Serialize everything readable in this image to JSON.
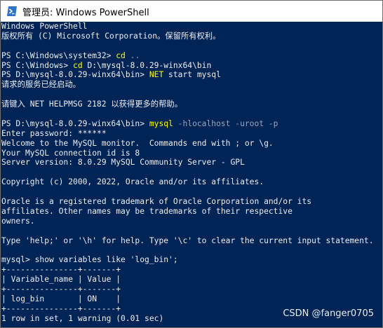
{
  "window": {
    "title": "管理员: Windows PowerShell",
    "icon": "powershell-icon"
  },
  "console": {
    "lines": [
      {
        "segments": [
          {
            "text": "Windows PowerShell",
            "style": "normal"
          }
        ]
      },
      {
        "segments": [
          {
            "text": "版权所有 (C) Microsoft Corporation。保留所有权利。",
            "style": "normal"
          }
        ]
      },
      {
        "segments": []
      },
      {
        "segments": [
          {
            "text": "PS C:\\Windows\\system32> ",
            "style": "normal"
          },
          {
            "text": "cd",
            "style": "yellow"
          },
          {
            "text": " ..",
            "style": "gray"
          }
        ]
      },
      {
        "segments": [
          {
            "text": "PS C:\\Windows> ",
            "style": "normal"
          },
          {
            "text": "cd",
            "style": "yellow"
          },
          {
            "text": " D:\\mysql-8.0.29-winx64\\bin",
            "style": "normal"
          }
        ]
      },
      {
        "segments": [
          {
            "text": "PS D:\\mysql-8.0.29-winx64\\bin> ",
            "style": "normal"
          },
          {
            "text": "NET",
            "style": "yellow"
          },
          {
            "text": " start mysql",
            "style": "normal"
          }
        ]
      },
      {
        "segments": [
          {
            "text": "请求的服务已经启动。",
            "style": "normal"
          }
        ]
      },
      {
        "segments": []
      },
      {
        "segments": [
          {
            "text": "请键入 NET HELPMSG 2182 以获得更多的帮助。",
            "style": "normal"
          }
        ]
      },
      {
        "segments": []
      },
      {
        "segments": [
          {
            "text": "PS D:\\mysql-8.0.29-winx64\\bin> ",
            "style": "normal"
          },
          {
            "text": "mysql",
            "style": "yellow"
          },
          {
            "text": " -hlocalhost -uroot -p",
            "style": "gray"
          }
        ]
      },
      {
        "segments": [
          {
            "text": "Enter password: ******",
            "style": "normal"
          }
        ]
      },
      {
        "segments": [
          {
            "text": "Welcome to the MySQL monitor.  Commands end with ; or \\g.",
            "style": "normal"
          }
        ]
      },
      {
        "segments": [
          {
            "text": "Your MySQL connection id is 8",
            "style": "normal"
          }
        ]
      },
      {
        "segments": [
          {
            "text": "Server version: 8.0.29 MySQL Community Server - GPL",
            "style": "normal"
          }
        ]
      },
      {
        "segments": []
      },
      {
        "segments": [
          {
            "text": "Copyright (c) 2000, 2022, Oracle and/or its affiliates.",
            "style": "normal"
          }
        ]
      },
      {
        "segments": []
      },
      {
        "segments": [
          {
            "text": "Oracle is a registered trademark of Oracle Corporation and/or its",
            "style": "normal"
          }
        ]
      },
      {
        "segments": [
          {
            "text": "affiliates. Other names may be trademarks of their respective",
            "style": "normal"
          }
        ]
      },
      {
        "segments": [
          {
            "text": "owners.",
            "style": "normal"
          }
        ]
      },
      {
        "segments": []
      },
      {
        "segments": [
          {
            "text": "Type 'help;' or '\\h' for help. Type '\\c' to clear the current input statement.",
            "style": "normal"
          }
        ]
      },
      {
        "segments": []
      },
      {
        "segments": [
          {
            "text": "mysql> show variables like 'log_bin';",
            "style": "normal"
          }
        ]
      },
      {
        "segments": [
          {
            "text": "+---------------+-------+",
            "style": "normal"
          }
        ]
      },
      {
        "segments": [
          {
            "text": "| Variable_name | Value |",
            "style": "normal"
          }
        ]
      },
      {
        "segments": [
          {
            "text": "+---------------+-------+",
            "style": "normal"
          }
        ]
      },
      {
        "segments": [
          {
            "text": "| log_bin       | ON    |",
            "style": "normal"
          }
        ]
      },
      {
        "segments": [
          {
            "text": "+---------------+-------+",
            "style": "normal"
          }
        ]
      },
      {
        "segments": [
          {
            "text": "1 row in set, 1 warning (0.01 sec)",
            "style": "normal"
          }
        ]
      }
    ]
  },
  "watermark": {
    "text": "CSDN @fanger0705"
  },
  "colors": {
    "console_background": "#012456",
    "console_text": "#eeedf0",
    "command_yellow": "#ffff00",
    "argument_gray": "#9aa5b8"
  }
}
